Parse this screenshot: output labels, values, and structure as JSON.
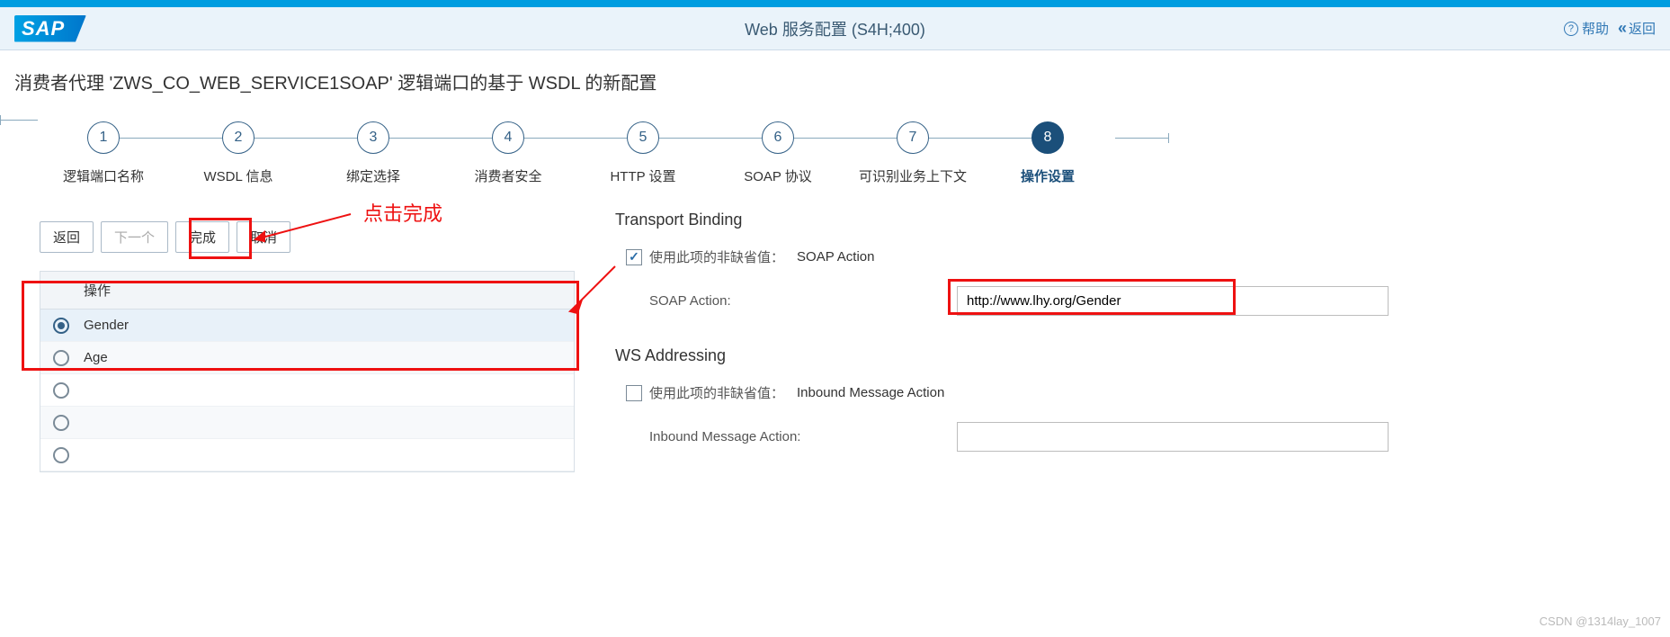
{
  "header": {
    "logo_text": "SAP",
    "title": "Web 服务配置 (S4H;400)",
    "help": "帮助",
    "back": "返回"
  },
  "page_title": "消费者代理 'ZWS_CO_WEB_SERVICE1SOAP' 逻辑端口的基于 WSDL 的新配置",
  "steps": [
    {
      "num": "1",
      "label": "逻辑端口名称"
    },
    {
      "num": "2",
      "label": "WSDL 信息"
    },
    {
      "num": "3",
      "label": "绑定选择"
    },
    {
      "num": "4",
      "label": "消费者安全"
    },
    {
      "num": "5",
      "label": "HTTP 设置"
    },
    {
      "num": "6",
      "label": "SOAP 协议"
    },
    {
      "num": "7",
      "label": "可识别业务上下文"
    },
    {
      "num": "8",
      "label": "操作设置"
    }
  ],
  "active_step": 7,
  "buttons": {
    "back": "返回",
    "next": "下一个",
    "finish": "完成",
    "cancel": "取消"
  },
  "table": {
    "header": "操作",
    "rows": [
      {
        "label": "Gender",
        "selected": true
      },
      {
        "label": "Age",
        "selected": false
      },
      {
        "label": "",
        "selected": false
      },
      {
        "label": "",
        "selected": false
      },
      {
        "label": "",
        "selected": false
      }
    ]
  },
  "right": {
    "section1_title": "Transport Binding",
    "non_default_label": "使用此项的非缺省值：",
    "soap_action_name": "SOAP Action",
    "soap_action_label": "SOAP Action:",
    "soap_action_value": "http://www.lhy.org/Gender",
    "section2_title": "WS Addressing",
    "inbound_name": "Inbound Message Action",
    "inbound_label": "Inbound Message Action:"
  },
  "annotations": {
    "click_finish": "点击完成"
  },
  "watermark": "CSDN @1314lay_1007"
}
